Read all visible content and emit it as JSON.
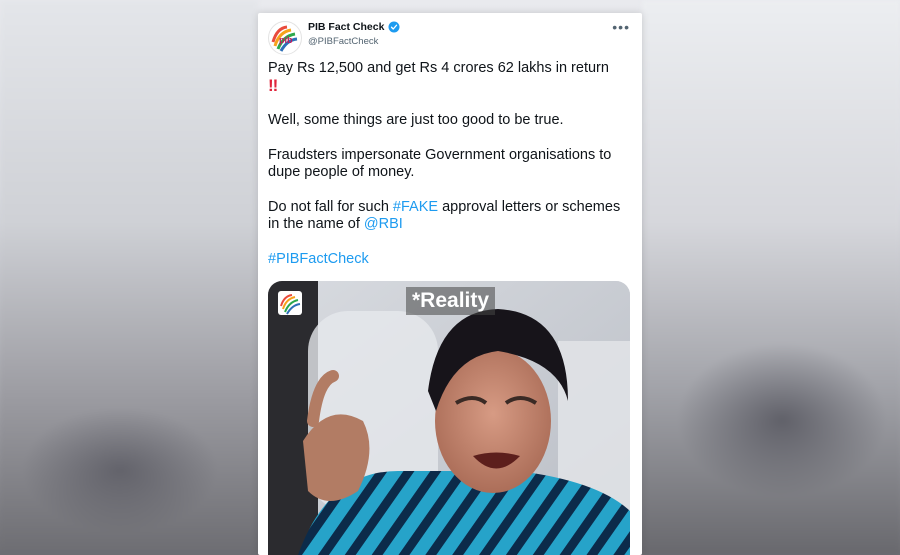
{
  "account": {
    "name": "PIB Fact Check",
    "handle": "@PIBFactCheck",
    "more_label": "•••"
  },
  "tweet": {
    "line1": "Pay Rs 12,500 and get Rs 4 crores 62 lakhs in return",
    "exclaim": "‼",
    "line2": "Well, some things are just too good to be true.",
    "line3a": "Fraudsters impersonate Government organisations to",
    "line3b": "dupe people of money.",
    "line4a_pre": "Do not fall for such ",
    "hashtag_fake": "#FAKE",
    "line4a_post": " approval letters or schemes",
    "line4b_pre": "in the name of ",
    "mention_rbi": "@RBI",
    "hashtag_main": "#PIBFactCheck"
  },
  "media": {
    "caption": "*Reality"
  },
  "colors": {
    "link": "#1d9bf0",
    "verified": "#1d9bf0",
    "bang": "#e0243b",
    "text": "#0f1419",
    "secondary": "#536471"
  },
  "icons": {
    "verified": "verified-badge-icon",
    "avatar": "pib-logo-icon"
  }
}
